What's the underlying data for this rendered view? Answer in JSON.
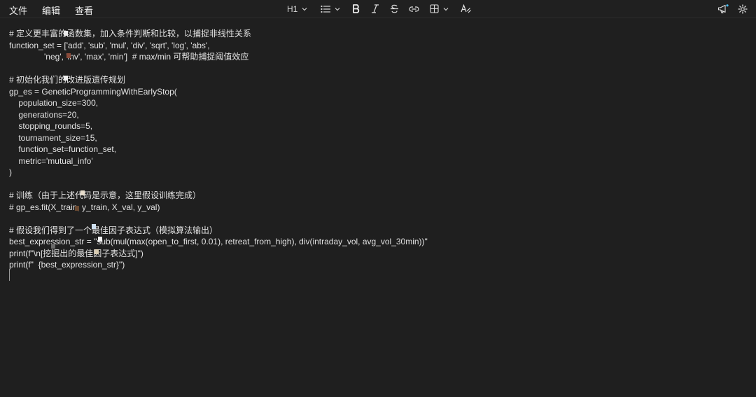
{
  "menu": {
    "file": "文件",
    "edit": "编辑",
    "view": "查看"
  },
  "toolbar": {
    "heading_label": "H1",
    "icons": [
      "chevron-down",
      "list",
      "bold",
      "italic",
      "strikethrough",
      "link",
      "table",
      "clear-formatting",
      "megaphone",
      "gear"
    ]
  },
  "editor": {
    "lines": [
      "# 定义更丰富的函数集，加入条件判断和比较，以捕捉非线性关系",
      "function_set = ['add', 'sub', 'mul', 'div', 'sqrt', 'log', 'abs',",
      "               'neg', 'inv', 'max', 'min']  # max/min 可帮助捕捉阈值效应",
      "",
      "# 初始化我们的改进版遗传规划",
      "gp_es = GeneticProgrammingWithEarlyStop(",
      "    population_size=300,",
      "    generations=20,",
      "    stopping_rounds=5,",
      "    tournament_size=15,",
      "    function_set=function_set,",
      "    metric='mutual_info'",
      ")",
      "",
      "# 训练（由于上述代码是示意，这里假设训练完成）",
      "# gp_es.fit(X_train, y_train, X_val, y_val)",
      "",
      "# 假设我们得到了一个最佳因子表达式（模拟算法输出）",
      "best_expression_str = \"sub(mul(max(open_to_first, 0.01), retreat_from_high), div(intraday_vol, avg_vol_30min))\"",
      "print(f\"\\n[挖掘出的最佳因子表达式]\")",
      "print(f\"  {best_expression_str}\")"
    ]
  }
}
